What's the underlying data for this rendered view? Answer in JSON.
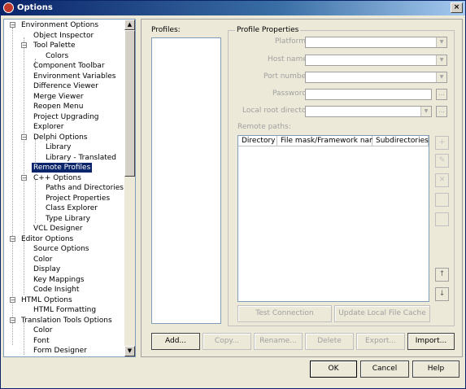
{
  "window": {
    "title": "Options",
    "close_label": "×"
  },
  "tree": {
    "items": [
      {
        "label": "Environment Options"
      },
      {
        "label": "Object Inspector"
      },
      {
        "label": "Tool Palette"
      },
      {
        "label": "Colors"
      },
      {
        "label": "Component Toolbar"
      },
      {
        "label": "Environment Variables"
      },
      {
        "label": "Difference Viewer"
      },
      {
        "label": "Merge Viewer"
      },
      {
        "label": "Reopen Menu"
      },
      {
        "label": "Project Upgrading"
      },
      {
        "label": "Explorer"
      },
      {
        "label": "Delphi Options"
      },
      {
        "label": "Library"
      },
      {
        "label": "Library - Translated"
      },
      {
        "label": "Remote Profiles"
      },
      {
        "label": "C++ Options"
      },
      {
        "label": "Paths and Directories"
      },
      {
        "label": "Project Properties"
      },
      {
        "label": "Class Explorer"
      },
      {
        "label": "Type Library"
      },
      {
        "label": "VCL Designer"
      },
      {
        "label": "Editor Options"
      },
      {
        "label": "Source Options"
      },
      {
        "label": "Color"
      },
      {
        "label": "Display"
      },
      {
        "label": "Key Mappings"
      },
      {
        "label": "Code Insight"
      },
      {
        "label": "HTML Options"
      },
      {
        "label": "HTML Formatting"
      },
      {
        "label": "Translation Tools Options"
      },
      {
        "label": "Color"
      },
      {
        "label": "Font"
      },
      {
        "label": "Form Designer"
      }
    ],
    "selected": "Remote Profiles"
  },
  "profiles": {
    "label": "Profiles:"
  },
  "properties": {
    "legend": "Profile Properties",
    "platform_label": "Platform:",
    "host_label": "Host name:",
    "port_label": "Port number:",
    "password_label": "Password:",
    "root_label": "Local root directory:",
    "remote_paths_label": "Remote paths:",
    "ellipsis": "...",
    "columns": [
      "Directory",
      "File mask/Framework name",
      "Subdirectories"
    ],
    "test_connection": "Test Connection",
    "update_cache": "Update Local File Cache"
  },
  "buttons": {
    "add": "Add...",
    "copy": "Copy...",
    "rename": "Rename...",
    "delete": "Delete",
    "export": "Export...",
    "import": "Import...",
    "ok": "OK",
    "cancel": "Cancel",
    "help": "Help"
  }
}
